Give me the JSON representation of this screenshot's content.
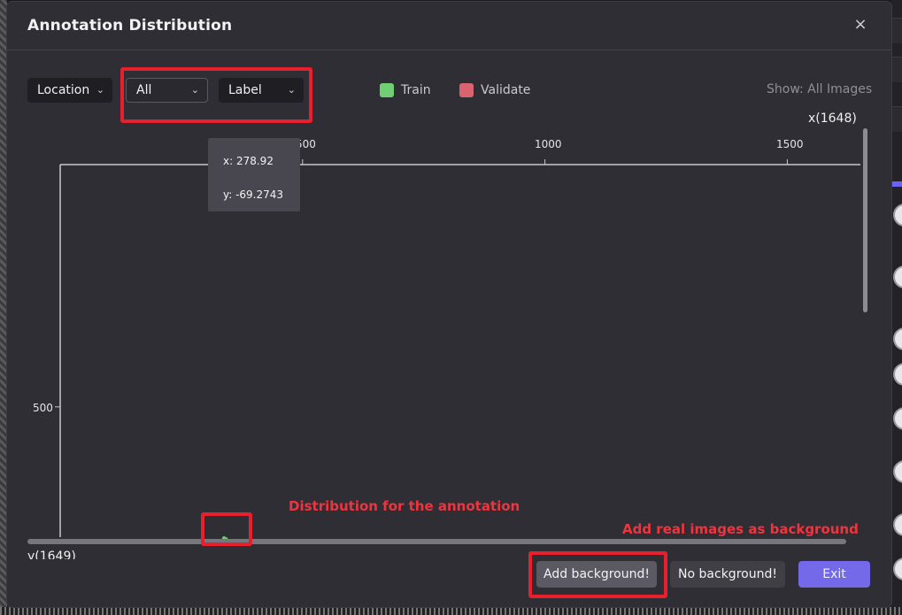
{
  "dialog": {
    "title": "Annotation Distribution",
    "close_label": "×"
  },
  "filters": {
    "location": {
      "label": "Location",
      "chevron": "⌄"
    },
    "scope": {
      "value": "All",
      "chevron": "⌄"
    },
    "group_by": {
      "label": "Label",
      "chevron": "⌄"
    }
  },
  "legend": [
    {
      "label": "Train",
      "color": "#6fcf73"
    },
    {
      "label": "Validate",
      "color": "#d9636e"
    }
  ],
  "show_filter": "Show: All Images",
  "chart_data": {
    "type": "scatter",
    "xlabel": "x(1648)",
    "ylabel": "y(1649)",
    "x_ticks": [
      "500",
      "1000",
      "1500"
    ],
    "y_ticks": [
      "500"
    ],
    "x_range": [
      0,
      1648
    ],
    "y_range": [
      0,
      1649
    ],
    "series": [
      {
        "name": "Train",
        "color": "#6fcf73",
        "points": [
          [
            338,
            771
          ],
          [
            342,
            773
          ]
        ]
      }
    ],
    "grid": false
  },
  "tooltip": {
    "x_text": "x: 278.92",
    "y_text": "y: -69.2743"
  },
  "annotations": {
    "distribution_note": "Distribution for the annotation",
    "background_note": "Add real images as background"
  },
  "buttons": {
    "add_background": "Add background!",
    "no_background": "No background!",
    "exit": "Exit"
  },
  "colors": {
    "accent": "#7469e8",
    "highlight": "#e8202e"
  }
}
